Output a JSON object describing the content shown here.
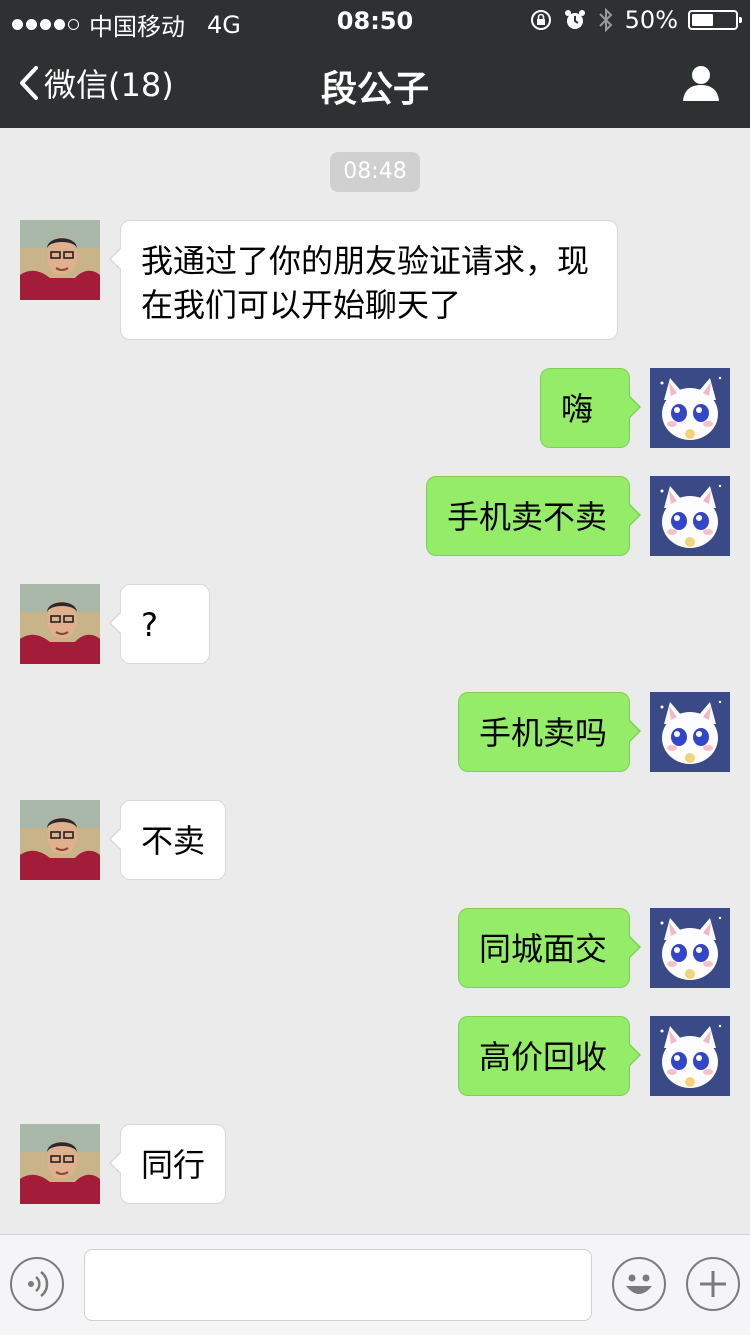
{
  "status": {
    "carrier": "中国移动",
    "network": "4G",
    "time": "08:50",
    "battery": "50%",
    "battery_level": 0.5
  },
  "nav": {
    "back_label": "微信(18)",
    "title": "段公子"
  },
  "chat": {
    "timestamp": "08:48",
    "messages": [
      {
        "side": "in",
        "text": "我通过了你的朋友验证请求，现在我们可以开始聊天了"
      },
      {
        "side": "out",
        "text": "嗨"
      },
      {
        "side": "out",
        "text": "手机卖不卖"
      },
      {
        "side": "in",
        "text": "?"
      },
      {
        "side": "out",
        "text": "手机卖吗"
      },
      {
        "side": "in",
        "text": "不卖"
      },
      {
        "side": "out",
        "text": "同城面交"
      },
      {
        "side": "out",
        "text": "高价回收"
      },
      {
        "side": "in",
        "text": "同行"
      }
    ]
  },
  "input": {
    "value": "",
    "voice_icon": "voice-icon",
    "emoji_icon": "emoji-icon",
    "plus_icon": "plus-icon"
  },
  "colors": {
    "header_bg": "#2e3132",
    "chat_bg": "#ebebeb",
    "outgoing_bubble": "#95ec69",
    "incoming_bubble": "#ffffff"
  }
}
